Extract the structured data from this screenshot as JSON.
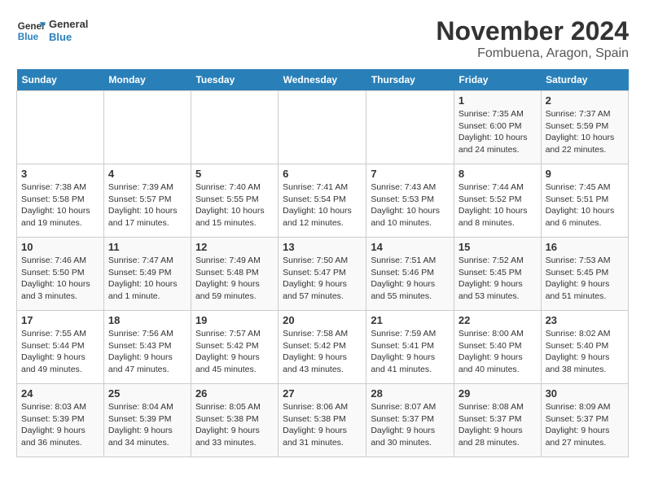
{
  "logo": {
    "general": "General",
    "blue": "Blue"
  },
  "header": {
    "title": "November 2024",
    "subtitle": "Fombuena, Aragon, Spain"
  },
  "days_of_week": [
    "Sunday",
    "Monday",
    "Tuesday",
    "Wednesday",
    "Thursday",
    "Friday",
    "Saturday"
  ],
  "weeks": [
    [
      {
        "day": "",
        "info": ""
      },
      {
        "day": "",
        "info": ""
      },
      {
        "day": "",
        "info": ""
      },
      {
        "day": "",
        "info": ""
      },
      {
        "day": "",
        "info": ""
      },
      {
        "day": "1",
        "info": "Sunrise: 7:35 AM\nSunset: 6:00 PM\nDaylight: 10 hours and 24 minutes."
      },
      {
        "day": "2",
        "info": "Sunrise: 7:37 AM\nSunset: 5:59 PM\nDaylight: 10 hours and 22 minutes."
      }
    ],
    [
      {
        "day": "3",
        "info": "Sunrise: 7:38 AM\nSunset: 5:58 PM\nDaylight: 10 hours and 19 minutes."
      },
      {
        "day": "4",
        "info": "Sunrise: 7:39 AM\nSunset: 5:57 PM\nDaylight: 10 hours and 17 minutes."
      },
      {
        "day": "5",
        "info": "Sunrise: 7:40 AM\nSunset: 5:55 PM\nDaylight: 10 hours and 15 minutes."
      },
      {
        "day": "6",
        "info": "Sunrise: 7:41 AM\nSunset: 5:54 PM\nDaylight: 10 hours and 12 minutes."
      },
      {
        "day": "7",
        "info": "Sunrise: 7:43 AM\nSunset: 5:53 PM\nDaylight: 10 hours and 10 minutes."
      },
      {
        "day": "8",
        "info": "Sunrise: 7:44 AM\nSunset: 5:52 PM\nDaylight: 10 hours and 8 minutes."
      },
      {
        "day": "9",
        "info": "Sunrise: 7:45 AM\nSunset: 5:51 PM\nDaylight: 10 hours and 6 minutes."
      }
    ],
    [
      {
        "day": "10",
        "info": "Sunrise: 7:46 AM\nSunset: 5:50 PM\nDaylight: 10 hours and 3 minutes."
      },
      {
        "day": "11",
        "info": "Sunrise: 7:47 AM\nSunset: 5:49 PM\nDaylight: 10 hours and 1 minute."
      },
      {
        "day": "12",
        "info": "Sunrise: 7:49 AM\nSunset: 5:48 PM\nDaylight: 9 hours and 59 minutes."
      },
      {
        "day": "13",
        "info": "Sunrise: 7:50 AM\nSunset: 5:47 PM\nDaylight: 9 hours and 57 minutes."
      },
      {
        "day": "14",
        "info": "Sunrise: 7:51 AM\nSunset: 5:46 PM\nDaylight: 9 hours and 55 minutes."
      },
      {
        "day": "15",
        "info": "Sunrise: 7:52 AM\nSunset: 5:45 PM\nDaylight: 9 hours and 53 minutes."
      },
      {
        "day": "16",
        "info": "Sunrise: 7:53 AM\nSunset: 5:45 PM\nDaylight: 9 hours and 51 minutes."
      }
    ],
    [
      {
        "day": "17",
        "info": "Sunrise: 7:55 AM\nSunset: 5:44 PM\nDaylight: 9 hours and 49 minutes."
      },
      {
        "day": "18",
        "info": "Sunrise: 7:56 AM\nSunset: 5:43 PM\nDaylight: 9 hours and 47 minutes."
      },
      {
        "day": "19",
        "info": "Sunrise: 7:57 AM\nSunset: 5:42 PM\nDaylight: 9 hours and 45 minutes."
      },
      {
        "day": "20",
        "info": "Sunrise: 7:58 AM\nSunset: 5:42 PM\nDaylight: 9 hours and 43 minutes."
      },
      {
        "day": "21",
        "info": "Sunrise: 7:59 AM\nSunset: 5:41 PM\nDaylight: 9 hours and 41 minutes."
      },
      {
        "day": "22",
        "info": "Sunrise: 8:00 AM\nSunset: 5:40 PM\nDaylight: 9 hours and 40 minutes."
      },
      {
        "day": "23",
        "info": "Sunrise: 8:02 AM\nSunset: 5:40 PM\nDaylight: 9 hours and 38 minutes."
      }
    ],
    [
      {
        "day": "24",
        "info": "Sunrise: 8:03 AM\nSunset: 5:39 PM\nDaylight: 9 hours and 36 minutes."
      },
      {
        "day": "25",
        "info": "Sunrise: 8:04 AM\nSunset: 5:39 PM\nDaylight: 9 hours and 34 minutes."
      },
      {
        "day": "26",
        "info": "Sunrise: 8:05 AM\nSunset: 5:38 PM\nDaylight: 9 hours and 33 minutes."
      },
      {
        "day": "27",
        "info": "Sunrise: 8:06 AM\nSunset: 5:38 PM\nDaylight: 9 hours and 31 minutes."
      },
      {
        "day": "28",
        "info": "Sunrise: 8:07 AM\nSunset: 5:37 PM\nDaylight: 9 hours and 30 minutes."
      },
      {
        "day": "29",
        "info": "Sunrise: 8:08 AM\nSunset: 5:37 PM\nDaylight: 9 hours and 28 minutes."
      },
      {
        "day": "30",
        "info": "Sunrise: 8:09 AM\nSunset: 5:37 PM\nDaylight: 9 hours and 27 minutes."
      }
    ]
  ]
}
